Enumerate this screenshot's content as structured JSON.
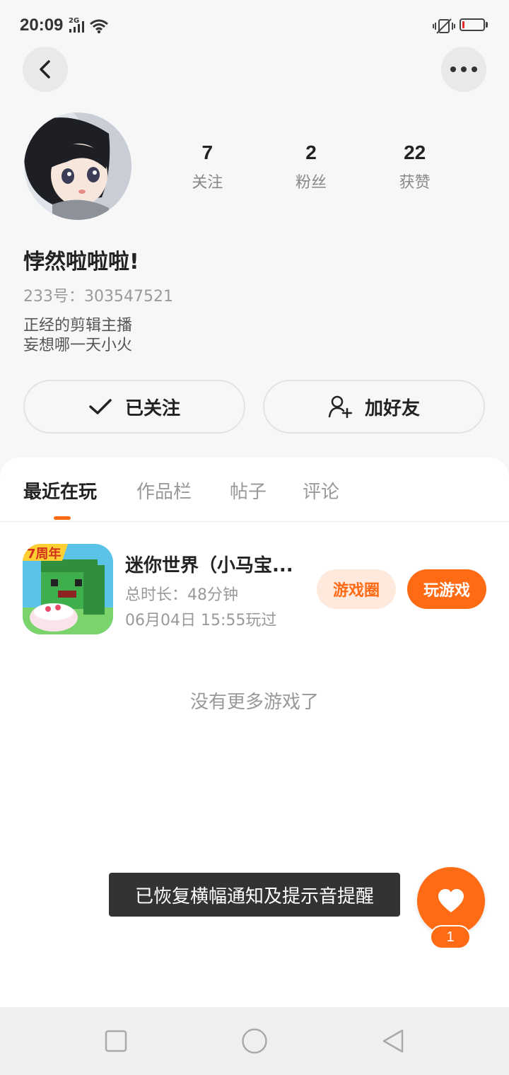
{
  "status_bar": {
    "time": "20:09",
    "network": "2G",
    "battery_level": 0.1,
    "battery_color": "#e12b2b"
  },
  "header": {
    "back_icon": "chevron-left-icon",
    "more_icon": "more-horizontal-icon"
  },
  "profile": {
    "nickname": "悖然啦啦啦!",
    "uid": "233号：303547521",
    "bio_lines": [
      "正经的剪辑主播",
      "妄想哪一天小火"
    ],
    "stats": [
      {
        "value": "7",
        "label": "关注"
      },
      {
        "value": "2",
        "label": "粉丝"
      },
      {
        "value": "22",
        "label": "获赞"
      }
    ],
    "follow_button": "已关注",
    "add_friend_button": "加好友"
  },
  "tabs": [
    {
      "label": "最近在玩",
      "active": true
    },
    {
      "label": "作品栏",
      "active": false
    },
    {
      "label": "帖子",
      "active": false
    },
    {
      "label": "评论",
      "active": false
    }
  ],
  "game": {
    "title": "迷你世界（小马宝...",
    "duration": "总时长：48分钟",
    "last_played": "06月04日 15:55玩过",
    "icon_badge": "7周年",
    "circle_button": "游戏圈",
    "play_button": "玩游戏"
  },
  "no_more_text": "没有更多游戏了",
  "toast": "已恢复横幅通知及提示音提醒",
  "like": {
    "count": "1",
    "icon": "heart-icon"
  },
  "accent_color": "#ff6a14",
  "nav_bar": {
    "recents_icon": "square-icon",
    "home_icon": "circle-icon",
    "back_icon": "triangle-back-icon"
  }
}
